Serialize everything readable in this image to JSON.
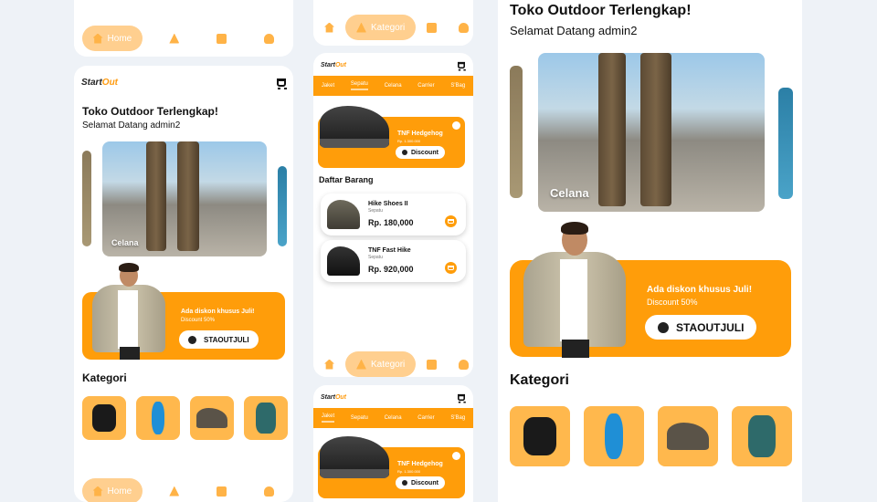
{
  "brand": {
    "start": "Start",
    "out": "Out"
  },
  "nav": {
    "home": "Home",
    "kategori": "Kategori"
  },
  "home": {
    "title": "Toko Outdoor Terlengkap!",
    "welcome": "Selamat Datang admin2",
    "carousel_label": "Celana",
    "promo_title": "Ada diskon khusus Juli!",
    "promo_sub": "Discount 50%",
    "coupon_code": "STAOUTJULI",
    "kategori_title": "Kategori"
  },
  "category": {
    "tabs": [
      "Jaket",
      "Sepatu",
      "Celana",
      "Carrier",
      "S'Bag"
    ],
    "active_tab": "Sepatu",
    "banner_name": "TNF Hedgehog",
    "banner_old_price": "Rp. 1.300.000",
    "discount_label": "Discount",
    "list_title": "Daftar Barang",
    "products": [
      {
        "name": "Hike Shoes II",
        "category": "Sepatu",
        "price": "Rp. 180,000"
      },
      {
        "name": "TNF Fast Hike",
        "category": "Sepatu",
        "price": "Rp. 920,000"
      }
    ]
  },
  "colors": {
    "accent": "#ff9d0a",
    "accent_light": "#ffcf8f",
    "background": "#eef2f7"
  },
  "icons": [
    "home-icon",
    "kategori-icon",
    "history-icon",
    "profile-icon",
    "cart-icon",
    "coupon-icon"
  ]
}
